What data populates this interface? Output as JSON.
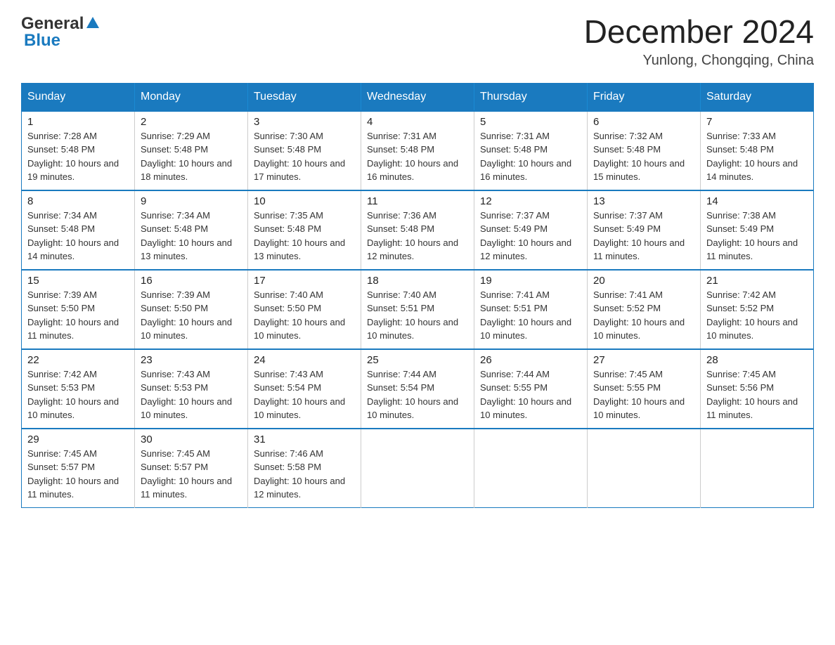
{
  "header": {
    "logo_general": "General",
    "logo_blue": "Blue",
    "month_title": "December 2024",
    "location": "Yunlong, Chongqing, China"
  },
  "weekdays": [
    "Sunday",
    "Monday",
    "Tuesday",
    "Wednesday",
    "Thursday",
    "Friday",
    "Saturday"
  ],
  "weeks": [
    [
      {
        "day": "1",
        "sunrise": "7:28 AM",
        "sunset": "5:48 PM",
        "daylight": "10 hours and 19 minutes."
      },
      {
        "day": "2",
        "sunrise": "7:29 AM",
        "sunset": "5:48 PM",
        "daylight": "10 hours and 18 minutes."
      },
      {
        "day": "3",
        "sunrise": "7:30 AM",
        "sunset": "5:48 PM",
        "daylight": "10 hours and 17 minutes."
      },
      {
        "day": "4",
        "sunrise": "7:31 AM",
        "sunset": "5:48 PM",
        "daylight": "10 hours and 16 minutes."
      },
      {
        "day": "5",
        "sunrise": "7:31 AM",
        "sunset": "5:48 PM",
        "daylight": "10 hours and 16 minutes."
      },
      {
        "day": "6",
        "sunrise": "7:32 AM",
        "sunset": "5:48 PM",
        "daylight": "10 hours and 15 minutes."
      },
      {
        "day": "7",
        "sunrise": "7:33 AM",
        "sunset": "5:48 PM",
        "daylight": "10 hours and 14 minutes."
      }
    ],
    [
      {
        "day": "8",
        "sunrise": "7:34 AM",
        "sunset": "5:48 PM",
        "daylight": "10 hours and 14 minutes."
      },
      {
        "day": "9",
        "sunrise": "7:34 AM",
        "sunset": "5:48 PM",
        "daylight": "10 hours and 13 minutes."
      },
      {
        "day": "10",
        "sunrise": "7:35 AM",
        "sunset": "5:48 PM",
        "daylight": "10 hours and 13 minutes."
      },
      {
        "day": "11",
        "sunrise": "7:36 AM",
        "sunset": "5:48 PM",
        "daylight": "10 hours and 12 minutes."
      },
      {
        "day": "12",
        "sunrise": "7:37 AM",
        "sunset": "5:49 PM",
        "daylight": "10 hours and 12 minutes."
      },
      {
        "day": "13",
        "sunrise": "7:37 AM",
        "sunset": "5:49 PM",
        "daylight": "10 hours and 11 minutes."
      },
      {
        "day": "14",
        "sunrise": "7:38 AM",
        "sunset": "5:49 PM",
        "daylight": "10 hours and 11 minutes."
      }
    ],
    [
      {
        "day": "15",
        "sunrise": "7:39 AM",
        "sunset": "5:50 PM",
        "daylight": "10 hours and 11 minutes."
      },
      {
        "day": "16",
        "sunrise": "7:39 AM",
        "sunset": "5:50 PM",
        "daylight": "10 hours and 10 minutes."
      },
      {
        "day": "17",
        "sunrise": "7:40 AM",
        "sunset": "5:50 PM",
        "daylight": "10 hours and 10 minutes."
      },
      {
        "day": "18",
        "sunrise": "7:40 AM",
        "sunset": "5:51 PM",
        "daylight": "10 hours and 10 minutes."
      },
      {
        "day": "19",
        "sunrise": "7:41 AM",
        "sunset": "5:51 PM",
        "daylight": "10 hours and 10 minutes."
      },
      {
        "day": "20",
        "sunrise": "7:41 AM",
        "sunset": "5:52 PM",
        "daylight": "10 hours and 10 minutes."
      },
      {
        "day": "21",
        "sunrise": "7:42 AM",
        "sunset": "5:52 PM",
        "daylight": "10 hours and 10 minutes."
      }
    ],
    [
      {
        "day": "22",
        "sunrise": "7:42 AM",
        "sunset": "5:53 PM",
        "daylight": "10 hours and 10 minutes."
      },
      {
        "day": "23",
        "sunrise": "7:43 AM",
        "sunset": "5:53 PM",
        "daylight": "10 hours and 10 minutes."
      },
      {
        "day": "24",
        "sunrise": "7:43 AM",
        "sunset": "5:54 PM",
        "daylight": "10 hours and 10 minutes."
      },
      {
        "day": "25",
        "sunrise": "7:44 AM",
        "sunset": "5:54 PM",
        "daylight": "10 hours and 10 minutes."
      },
      {
        "day": "26",
        "sunrise": "7:44 AM",
        "sunset": "5:55 PM",
        "daylight": "10 hours and 10 minutes."
      },
      {
        "day": "27",
        "sunrise": "7:45 AM",
        "sunset": "5:55 PM",
        "daylight": "10 hours and 10 minutes."
      },
      {
        "day": "28",
        "sunrise": "7:45 AM",
        "sunset": "5:56 PM",
        "daylight": "10 hours and 11 minutes."
      }
    ],
    [
      {
        "day": "29",
        "sunrise": "7:45 AM",
        "sunset": "5:57 PM",
        "daylight": "10 hours and 11 minutes."
      },
      {
        "day": "30",
        "sunrise": "7:45 AM",
        "sunset": "5:57 PM",
        "daylight": "10 hours and 11 minutes."
      },
      {
        "day": "31",
        "sunrise": "7:46 AM",
        "sunset": "5:58 PM",
        "daylight": "10 hours and 12 minutes."
      },
      null,
      null,
      null,
      null
    ]
  ]
}
